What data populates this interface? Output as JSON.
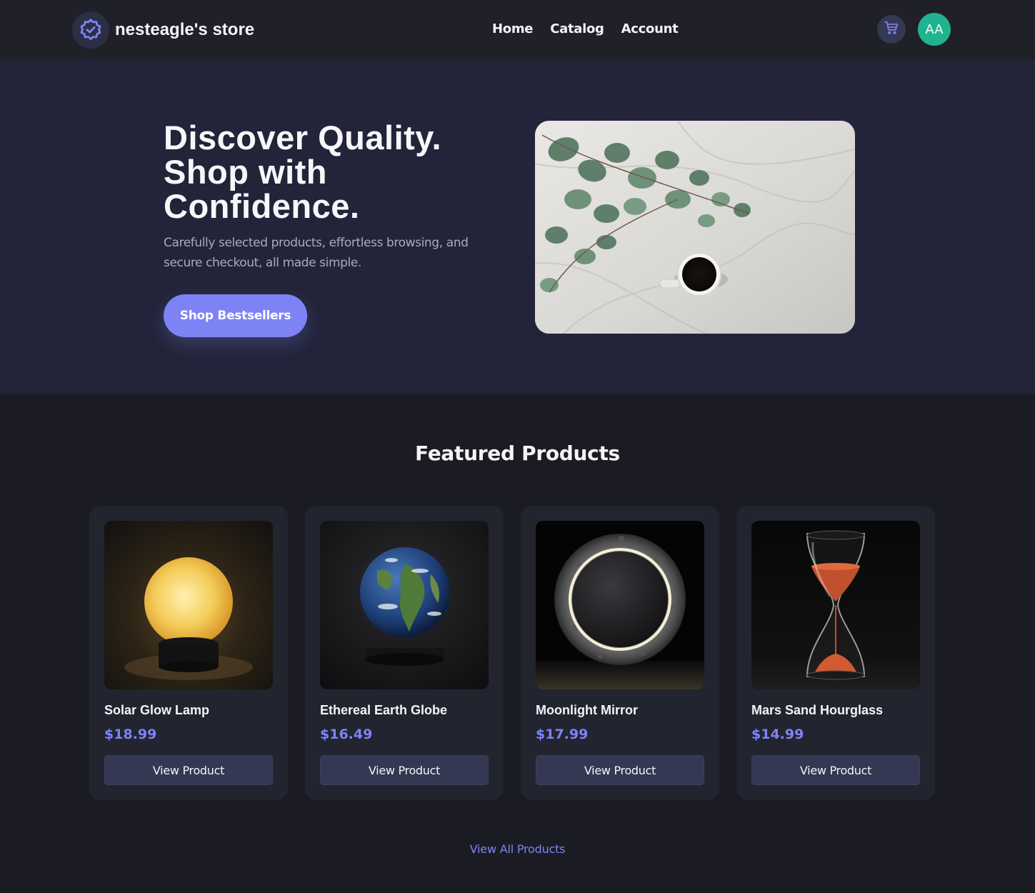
{
  "header": {
    "store_name": "nesteagle's store",
    "logo_icon": "verified-badge-icon",
    "nav": [
      "Home",
      "Catalog",
      "Account"
    ],
    "cart_icon": "shopping-cart-icon",
    "avatar_initials": "AA",
    "avatar_color": "#1fb38f"
  },
  "hero": {
    "title_lines": [
      "Discover Quality.",
      "Shop with",
      "Confidence."
    ],
    "subtitle": "Carefully selected products, effortless browsing, and secure checkout, all made simple.",
    "cta": "Shop Bestsellers"
  },
  "featured": {
    "title": "Featured Products",
    "products": [
      {
        "name": "Solar Glow Lamp",
        "price": "$18.99",
        "button": "View Product"
      },
      {
        "name": "Ethereal Earth Globe",
        "price": "$16.49",
        "button": "View Product"
      },
      {
        "name": "Moonlight Mirror",
        "price": "$17.99",
        "button": "View Product"
      },
      {
        "name": "Mars Sand Hourglass",
        "price": "$14.99",
        "button": "View Product"
      }
    ],
    "view_all": "View All Products"
  },
  "colors": {
    "accent": "#7d83f5",
    "background": "#1b1c23",
    "hero_bg": "#23243a",
    "card_bg": "#222430"
  }
}
